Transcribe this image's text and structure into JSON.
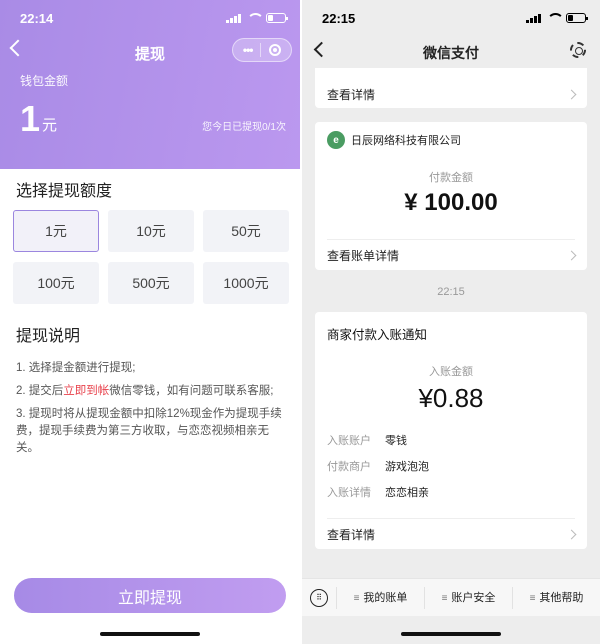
{
  "left": {
    "status_time": "22:14",
    "title": "提现",
    "wallet_label": "钱包金额",
    "balance_value": "1",
    "balance_unit": "元",
    "today_limit": "您今日已提现0/1次",
    "section_title": "选择提现额度",
    "amounts": [
      "1元",
      "10元",
      "50元",
      "100元",
      "500元",
      "1000元"
    ],
    "selected_amount": "1元",
    "notes_title": "提现说明",
    "note1": "1. 选择提金额进行提现;",
    "note2_pre": "2. 提交后",
    "note2_highlight": "立即到帐",
    "note2_post": "微信零钱，如有问题可联系客服;",
    "note3": "3. 提现时将从提现金额中扣除12%现金作为提现手续费，提现手续费为第三方收取，与恋恋视频相亲无关。",
    "submit_label": "立即提现",
    "accent_color": "#a98be6"
  },
  "right": {
    "status_time": "22:15",
    "title": "微信支付",
    "top_link": "查看详情",
    "merchant_name": "日辰网络科技有限公司",
    "pay_label": "付款金额",
    "pay_amount": "¥ 100.00",
    "bill_detail": "查看账单详情",
    "time_chip": "22:15",
    "notice_title": "商家付款入账通知",
    "in_label": "入账金额",
    "in_amount": "¥0.88",
    "kv": [
      {
        "k": "入账账户",
        "v": "零钱"
      },
      {
        "k": "付款商户",
        "v": "游戏泡泡"
      },
      {
        "k": "入账详情",
        "v": "恋恋相亲"
      }
    ],
    "notice_link": "查看详情",
    "tabs": [
      "我的账单",
      "账户安全",
      "其他帮助"
    ]
  }
}
